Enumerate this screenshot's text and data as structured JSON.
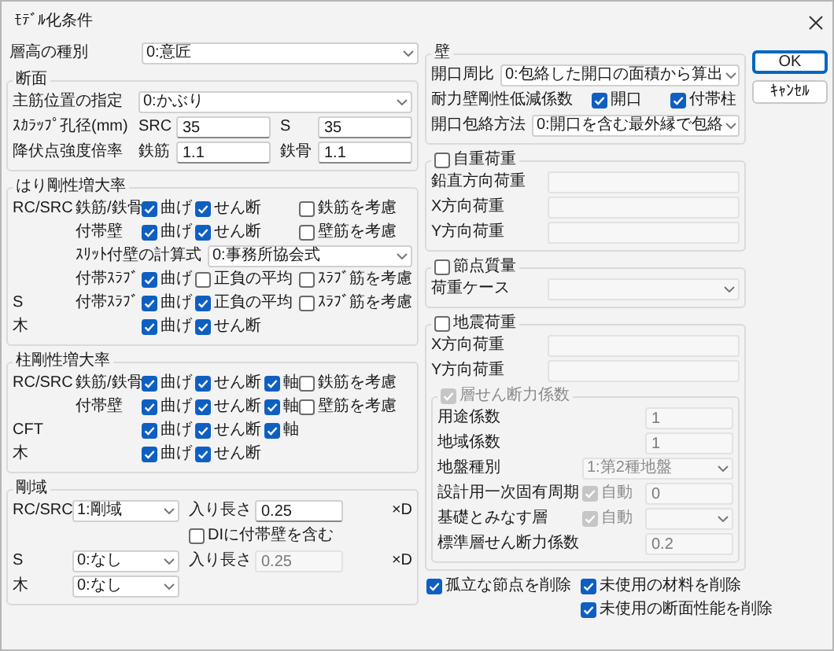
{
  "window": {
    "title": "ﾓﾃﾞﾙ化条件"
  },
  "story_height": {
    "label": "層高の種別",
    "value": "0:意匠"
  },
  "section": {
    "title": "断面",
    "rows": [
      {
        "kind": "select",
        "label": "主筋位置の指定",
        "value": "0:かぶり"
      },
      {
        "kind": "pair",
        "label": "ｽｶﾗｯﾌﾟ孔径(mm)",
        "fields": [
          {
            "label": "SRC",
            "value": "35"
          },
          {
            "label": "S",
            "value": "35"
          }
        ]
      },
      {
        "kind": "pair",
        "label": "降伏点強度倍率",
        "fields": [
          {
            "label": "鉄筋",
            "value": "1.1"
          },
          {
            "label": "鉄骨",
            "value": "1.1"
          }
        ]
      }
    ]
  },
  "beam": {
    "title": "はり剛性増大率",
    "rows": [
      {
        "kind": "checks",
        "type": "RC/SRC",
        "label": "鉄筋/鉄骨",
        "checks": [
          {
            "label": "曲げ",
            "checked": true
          },
          {
            "label": "せん断",
            "checked": true
          },
          {
            "label": "鉄筋を考慮",
            "checked": false
          }
        ]
      },
      {
        "kind": "checks",
        "label": "付帯壁",
        "checks": [
          {
            "label": "曲げ",
            "checked": true
          },
          {
            "label": "せん断",
            "checked": true
          },
          {
            "label": "壁筋を考慮",
            "checked": false
          }
        ]
      },
      {
        "kind": "select",
        "label": "ｽﾘｯﾄ付壁の計算式",
        "value": "0:事務所協会式"
      },
      {
        "kind": "checks",
        "label": "付帯ｽﾗﾌﾞ",
        "checks": [
          {
            "label": "曲げ",
            "checked": true
          },
          {
            "label": "正負の平均",
            "checked": false
          },
          {
            "label": "ｽﾗﾌﾞ筋を考慮",
            "checked": false
          }
        ]
      },
      {
        "kind": "checks",
        "type": "S",
        "label": "付帯ｽﾗﾌﾞ",
        "checks": [
          {
            "label": "曲げ",
            "checked": true
          },
          {
            "label": "正負の平均",
            "checked": true
          },
          {
            "label": "ｽﾗﾌﾞ筋を考慮",
            "checked": false
          }
        ]
      },
      {
        "kind": "checks",
        "type": "木",
        "checks": [
          {
            "label": "曲げ",
            "checked": true
          },
          {
            "label": "せん断",
            "checked": true
          }
        ]
      }
    ]
  },
  "column": {
    "title": "柱剛性増大率",
    "rows": [
      {
        "kind": "checks",
        "type": "RC/SRC",
        "label": "鉄筋/鉄骨",
        "checks": [
          {
            "label": "曲げ",
            "checked": true
          },
          {
            "label": "せん断",
            "checked": true
          },
          {
            "label": "軸",
            "checked": true
          },
          {
            "label": "鉄筋を考慮",
            "checked": false
          }
        ]
      },
      {
        "kind": "checks",
        "label": "付帯壁",
        "checks": [
          {
            "label": "曲げ",
            "checked": true
          },
          {
            "label": "せん断",
            "checked": true
          },
          {
            "label": "軸",
            "checked": true
          },
          {
            "label": "壁筋を考慮",
            "checked": false
          }
        ]
      },
      {
        "kind": "checks",
        "type": "CFT",
        "checks": [
          {
            "label": "曲げ",
            "checked": true
          },
          {
            "label": "せん断",
            "checked": true
          },
          {
            "label": "軸",
            "checked": true
          }
        ]
      },
      {
        "kind": "checks",
        "type": "木",
        "checks": [
          {
            "label": "曲げ",
            "checked": true
          },
          {
            "label": "せん断",
            "checked": true
          }
        ]
      }
    ]
  },
  "rigid_zone": {
    "title": "剛域",
    "rows": [
      {
        "kind": "length",
        "type": "RC/SRC",
        "value": "1:剛域",
        "length_label": "入り長さ",
        "length": "0.25",
        "length_disabled": false,
        "unit": "×D"
      },
      {
        "kind": "check",
        "label": "DIに付帯壁を含む",
        "checked": false
      },
      {
        "kind": "length",
        "type": "S",
        "value": "0:なし",
        "length_label": "入り長さ",
        "length": "0.25",
        "length_disabled": true,
        "unit": "×D"
      },
      {
        "kind": "select",
        "type": "木",
        "value": "0:なし"
      }
    ]
  },
  "wall": {
    "title": "壁",
    "rows": [
      {
        "kind": "select",
        "label": "開口周比",
        "value": "0:包絡した開口の面積から算出"
      },
      {
        "kind": "checks",
        "label": "耐力壁剛性低減係数",
        "checks": [
          {
            "label": "開口",
            "checked": true
          },
          {
            "label": "付帯柱",
            "checked": true
          }
        ]
      },
      {
        "kind": "select",
        "label": "開口包絡方法",
        "value": "0:開口を含む最外縁で包絡"
      }
    ]
  },
  "self_weight": {
    "title": "自重荷重",
    "checked": false,
    "rows": [
      {
        "kind": "input",
        "label": "鉛直方向荷重",
        "disabled": true
      },
      {
        "kind": "input",
        "label": "X方向荷重",
        "disabled": true
      },
      {
        "kind": "input",
        "label": "Y方向荷重",
        "disabled": true
      }
    ]
  },
  "nodal_mass": {
    "title": "節点質量",
    "checked": false,
    "rows": [
      {
        "kind": "select",
        "label": "荷重ケース",
        "disabled": true
      }
    ]
  },
  "seismic": {
    "title": "地震荷重",
    "checked": false,
    "rows": [
      {
        "kind": "input",
        "label": "X方向荷重",
        "disabled": true
      },
      {
        "kind": "input",
        "label": "Y方向荷重",
        "disabled": true
      }
    ],
    "shear": {
      "title": "層せん断力係数",
      "checked": true,
      "disabled": true,
      "rows": [
        {
          "kind": "input",
          "label": "用途係数",
          "value": "1",
          "disabled": true
        },
        {
          "kind": "input",
          "label": "地域係数",
          "value": "1",
          "disabled": true
        },
        {
          "kind": "select",
          "label": "地盤種別",
          "value": "1:第2種地盤",
          "disabled": true
        },
        {
          "kind": "auto_input",
          "label": "設計用一次固有周期",
          "auto": {
            "label": "自動",
            "checked": true,
            "disabled": true
          },
          "value": "0",
          "disabled": true
        },
        {
          "kind": "auto_select",
          "label": "基礎とみなす層",
          "auto": {
            "label": "自動",
            "checked": true,
            "disabled": true
          },
          "disabled": true
        },
        {
          "kind": "input",
          "label": "標準層せん断力係数",
          "value": "0.2",
          "disabled": true
        }
      ]
    }
  },
  "options": [
    {
      "label": "孤立な節点を削除",
      "checked": true
    },
    {
      "label": "未使用の材料を削除",
      "checked": true
    },
    {
      "label": "未使用の断面性能を削除",
      "checked": true
    }
  ],
  "buttons": [
    {
      "label": "OK",
      "default": true
    },
    {
      "label": "ｷｬﾝｾﾙ",
      "default": false
    }
  ]
}
